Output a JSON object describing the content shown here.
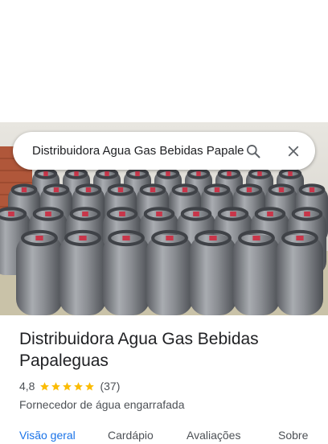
{
  "search": {
    "query": "Distribuidora Agua Gas Bebidas Papaleguas"
  },
  "place": {
    "name": "Distribuidora Agua Gas Bebidas Papaleguas",
    "rating": "4,8",
    "stars": 5,
    "review_count": "(37)",
    "category": "Fornecedor de água engarrafada"
  },
  "tabs": [
    {
      "label": "Visão geral",
      "active": true
    },
    {
      "label": "Cardápio",
      "active": false
    },
    {
      "label": "Avaliações",
      "active": false
    },
    {
      "label": "Sobre",
      "active": false
    }
  ],
  "icons": {
    "search": "search-icon",
    "close": "close-icon",
    "star": "star-icon"
  },
  "colors": {
    "accent": "#1a73e8",
    "star": "#fbbc04",
    "text_primary": "#202124",
    "text_secondary": "#4d5156"
  }
}
